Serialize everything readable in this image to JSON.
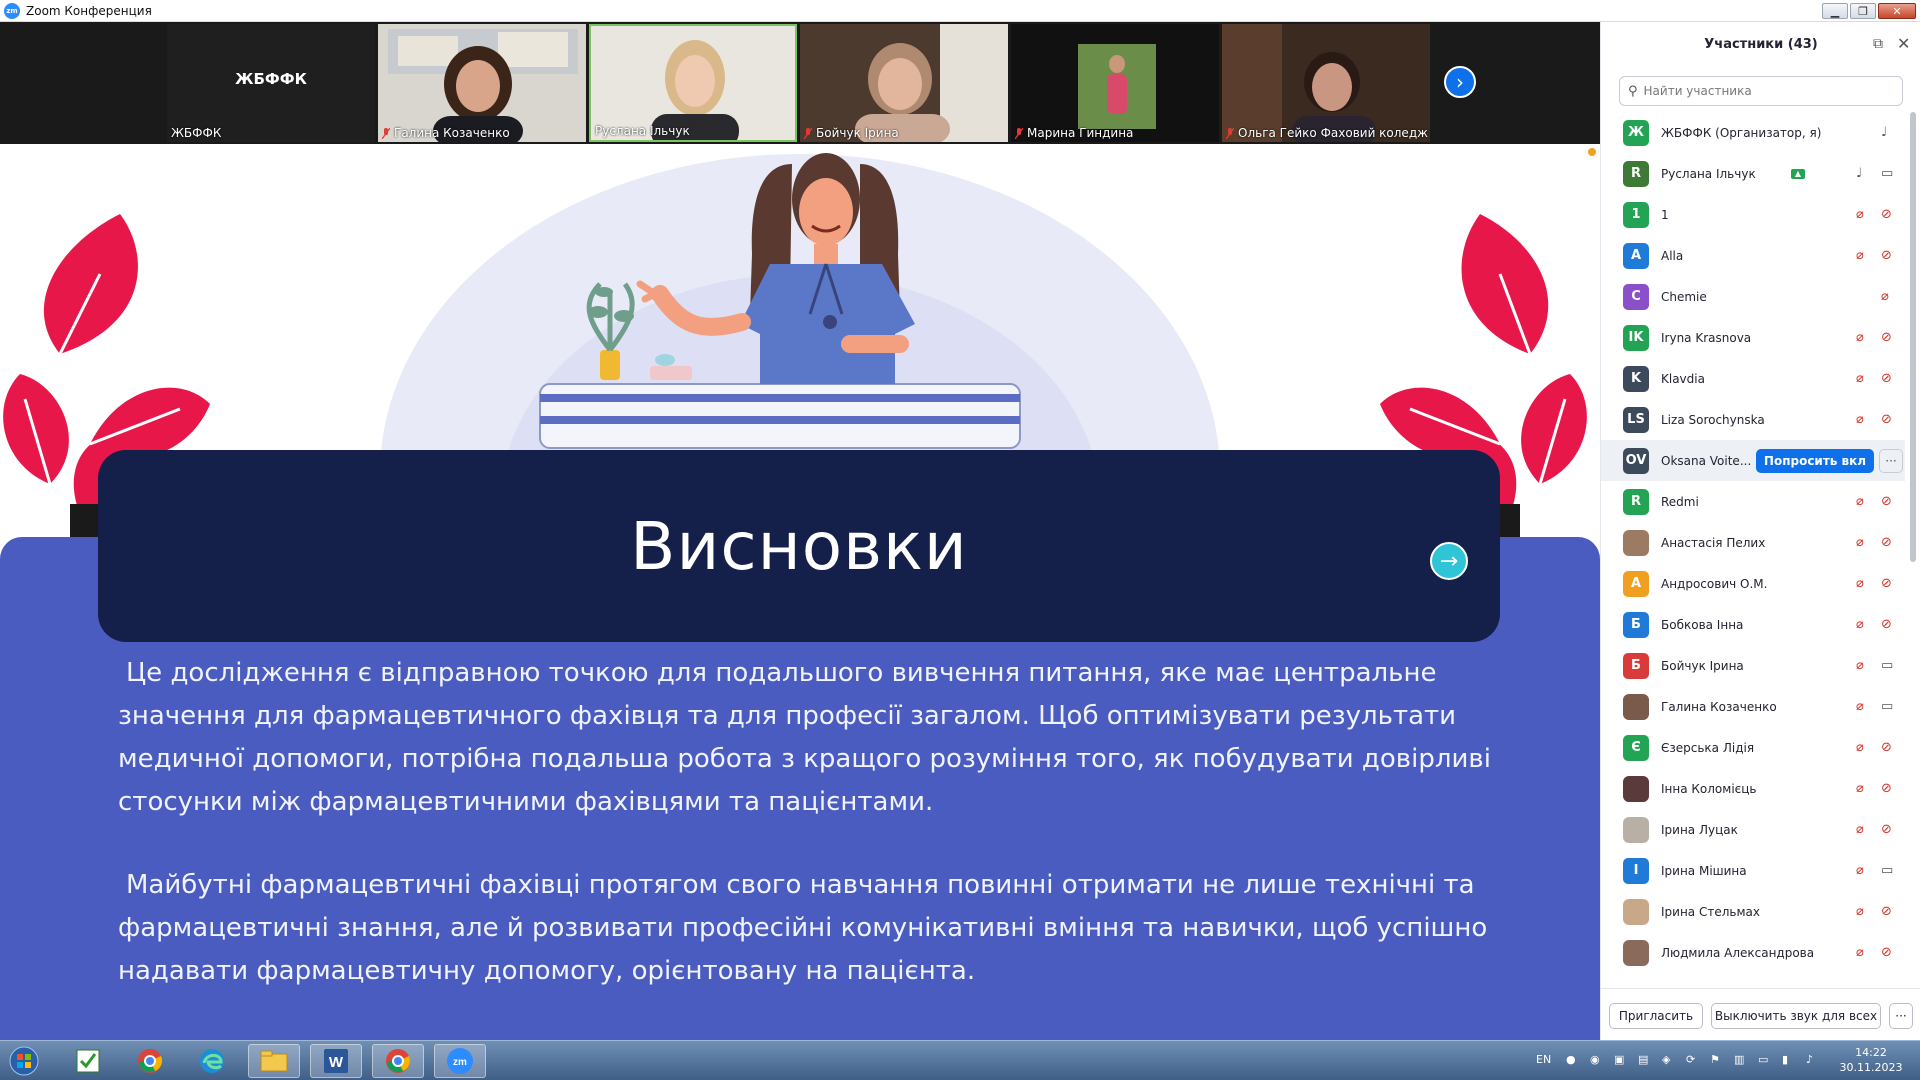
{
  "window": {
    "title": "Zoom Конференция"
  },
  "filmstrip": {
    "tiles": [
      {
        "name": "ЖБФФК",
        "center_label": "ЖБФФК",
        "muted": false
      },
      {
        "name": "Галина Козаченко",
        "muted": true
      },
      {
        "name": "Руслана Ільчук",
        "muted": false
      },
      {
        "name": "Бойчук Ірина",
        "muted": true
      },
      {
        "name": "Марина Гиндина",
        "muted": true
      },
      {
        "name": "Ольга Гейко Фаховий коледж",
        "muted": true
      }
    ]
  },
  "slide": {
    "title": "Висновки",
    "paragraphs": [
      "Це дослідження є відправною точкою для подальшого вивчення питання, яке має центральне значення для фармацевтичного фахівця та для професії загалом. Щоб оптимізувати результати медичної допомоги, потрібна подальша робота з кращого розуміння того, як побудувати довірливі стосунки між фармацевтичними фахівцями та пацієнтами.",
      "Майбутні фармацевтичні фахівці протягом свого навчання повинні отримати не лише технічні та фармацевтичні знання, але й розвивати професійні комунікативні вміння та навички, щоб успішно надавати фармацевтичну допомогу, орієнтовану на пацієнта."
    ],
    "colors": {
      "band": "#4a5cc0",
      "title_box": "#14204a",
      "leaves": "#e8174a",
      "arrow": "#2fc4d6"
    }
  },
  "participants": {
    "header": "Участники (43)",
    "search_placeholder": "Найти участника",
    "ask_button": "Попросить вкл",
    "more": "···",
    "list": [
      {
        "initials": "Ж",
        "name": "ЖБФФК (Организатор, я)",
        "color": "#23a455",
        "mic": "on",
        "video": "none"
      },
      {
        "initials": "R",
        "name": "Руслана Ільчук",
        "color": "#3d7a35",
        "mic": "on",
        "video": "off-gray",
        "share": true
      },
      {
        "initials": "1",
        "name": "1",
        "color": "#23a455",
        "mic": "muted",
        "video": "off"
      },
      {
        "initials": "A",
        "name": "Alla",
        "color": "#1f7ad8",
        "mic": "muted",
        "video": "off"
      },
      {
        "initials": "C",
        "name": "Chemie",
        "color": "#8a4fc9",
        "mic": "muted",
        "video": "none"
      },
      {
        "initials": "IK",
        "name": "Iryna Krasnova",
        "color": "#23a455",
        "mic": "muted",
        "video": "off"
      },
      {
        "initials": "K",
        "name": "Klavdia",
        "color": "#3d4a5c",
        "mic": "muted",
        "video": "off"
      },
      {
        "initials": "LS",
        "name": "Liza Sorochynska",
        "color": "#3d4a5c",
        "mic": "muted",
        "video": "off"
      },
      {
        "initials": "OV",
        "name": "Oksana Voite...",
        "color": "#3d4a5c",
        "mic": "ask",
        "video": "none",
        "highlight": true
      },
      {
        "initials": "R",
        "name": "Redmi",
        "color": "#23a455",
        "mic": "muted",
        "video": "off"
      },
      {
        "initials": "",
        "name": "Анастасія Пелих",
        "color": "#9c7b62",
        "mic": "muted",
        "video": "off",
        "photo": true
      },
      {
        "initials": "А",
        "name": "Андросович О.М.",
        "color": "#f0a020",
        "mic": "muted",
        "video": "off"
      },
      {
        "initials": "Б",
        "name": "Бобкова Інна",
        "color": "#1f7ad8",
        "mic": "muted",
        "video": "off"
      },
      {
        "initials": "Б",
        "name": "Бойчук Ірина",
        "color": "#d93a3a",
        "mic": "muted",
        "video": "off-gray"
      },
      {
        "initials": "",
        "name": "Галина Козаченко",
        "color": "#7a5a4a",
        "mic": "muted",
        "video": "off-gray",
        "photo": true
      },
      {
        "initials": "Є",
        "name": "Єзерська Лідія",
        "color": "#23a455",
        "mic": "muted",
        "video": "off"
      },
      {
        "initials": "",
        "name": "Інна Коломієць",
        "color": "#5a3a3a",
        "mic": "muted",
        "video": "off",
        "photo": true
      },
      {
        "initials": "",
        "name": "Ірина Луцак",
        "color": "#b8b0a4",
        "mic": "muted",
        "video": "off",
        "photo": true
      },
      {
        "initials": "І",
        "name": "Ірина Мішина",
        "color": "#1f7ad8",
        "mic": "muted",
        "video": "off-gray"
      },
      {
        "initials": "",
        "name": "Ірина Стельмах",
        "color": "#c8a888",
        "mic": "muted",
        "video": "off",
        "photo": true
      },
      {
        "initials": "",
        "name": "Людмила Александрова",
        "color": "#8a6a5a",
        "mic": "muted",
        "video": "off",
        "photo": true
      }
    ],
    "invite": "Пригласить",
    "mute_all": "Выключить звук для всех"
  },
  "taskbar": {
    "lang": "EN",
    "time": "14:22",
    "date": "30.11.2023"
  }
}
